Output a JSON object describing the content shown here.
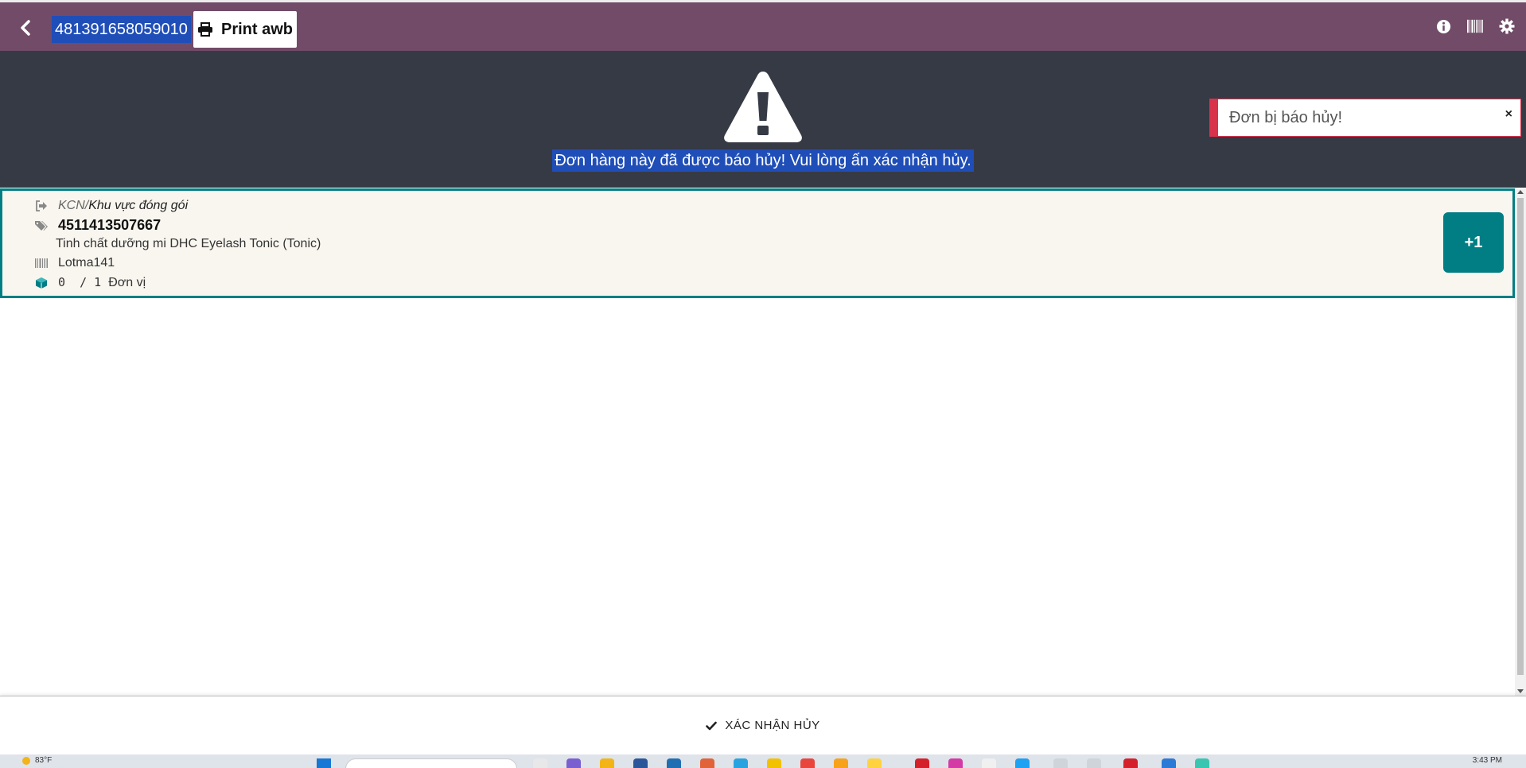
{
  "header": {
    "reference": "481391658059010",
    "print_label": "Print awb",
    "icons": [
      "back-icon",
      "info-icon",
      "barcode-icon",
      "gear-icon"
    ]
  },
  "banner": {
    "message": "Đơn hàng này đã được báo hủy! Vui lòng ấn xác nhận hủy.",
    "icon": "warning-icon"
  },
  "toast": {
    "message": "Đơn bị báo hủy!",
    "close": "×",
    "color": "#d9324b"
  },
  "line": {
    "location_prefix": "KCN/",
    "location": "Khu vực đóng gói",
    "barcode": "4511413507667",
    "product": "Tinh chất dưỡng mi DHC Eyelash Tonic (Tonic)",
    "lot": "Lotma141",
    "qty_done": "0",
    "qty_sep": "/",
    "qty_total": "1",
    "uom": "Đơn vị",
    "increment_label": "+1"
  },
  "footer": {
    "confirm_label": "XÁC NHẬN HỦY"
  },
  "taskbar": {
    "weather": "83°F",
    "time": "3:43 PM"
  },
  "colors": {
    "brand": "#714b67",
    "banner": "#363a45",
    "accent": "#017e84",
    "selection": "#1f4eb8"
  }
}
